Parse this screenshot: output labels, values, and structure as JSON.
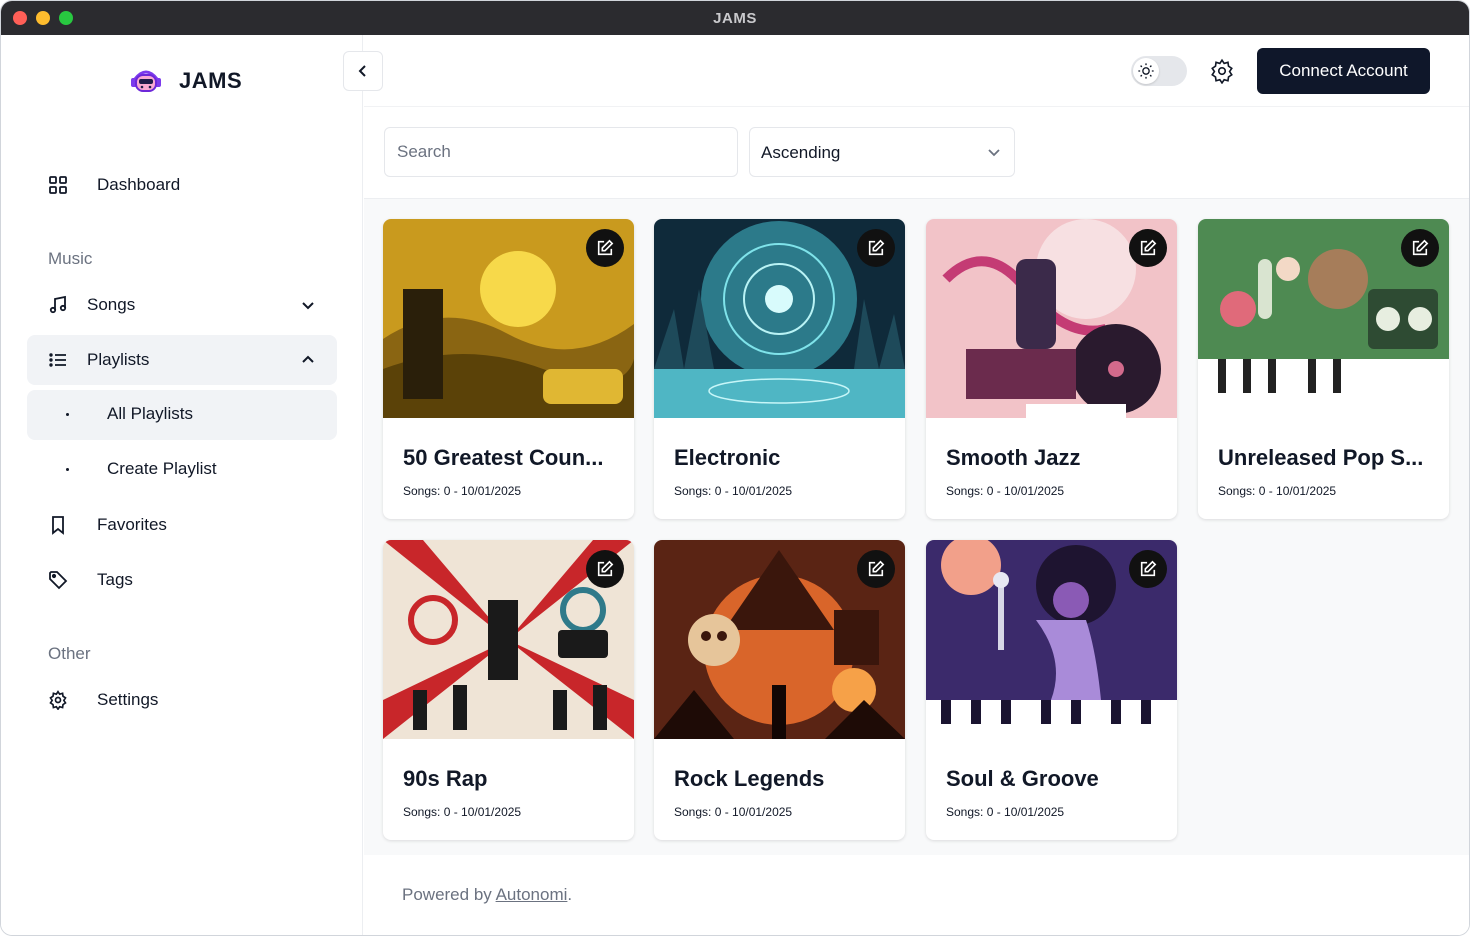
{
  "window": {
    "title": "JAMS"
  },
  "brand": {
    "name": "JAMS"
  },
  "sidebar": {
    "dashboard": "Dashboard",
    "section_music": "Music",
    "songs": "Songs",
    "playlists": "Playlists",
    "all_playlists": "All Playlists",
    "create_playlist": "Create Playlist",
    "favorites": "Favorites",
    "tags": "Tags",
    "section_other": "Other",
    "settings": "Settings"
  },
  "topbar": {
    "connect_label": "Connect Account"
  },
  "filters": {
    "search_placeholder": "Search",
    "sort_value": "Ascending"
  },
  "playlists": [
    {
      "title": "50 Greatest Coun...",
      "meta": "Songs: 0 - 10/01/2025"
    },
    {
      "title": "Electronic",
      "meta": "Songs: 0 - 10/01/2025"
    },
    {
      "title": "Smooth Jazz",
      "meta": "Songs: 0 - 10/01/2025"
    },
    {
      "title": "Unreleased Pop S...",
      "meta": "Songs: 0 - 10/01/2025"
    },
    {
      "title": "90s Rap",
      "meta": "Songs: 0 - 10/01/2025"
    },
    {
      "title": "Rock Legends",
      "meta": "Songs: 0 - 10/01/2025"
    },
    {
      "title": "Soul & Groove",
      "meta": "Songs: 0 - 10/01/2025"
    }
  ],
  "footer": {
    "prefix": "Powered by",
    "link": "Autonomi",
    "suffix": "."
  },
  "colors": {
    "primary_button": "#0f172a",
    "active_nav": "#f1f3f6",
    "content_bg": "#f8f9fa"
  }
}
